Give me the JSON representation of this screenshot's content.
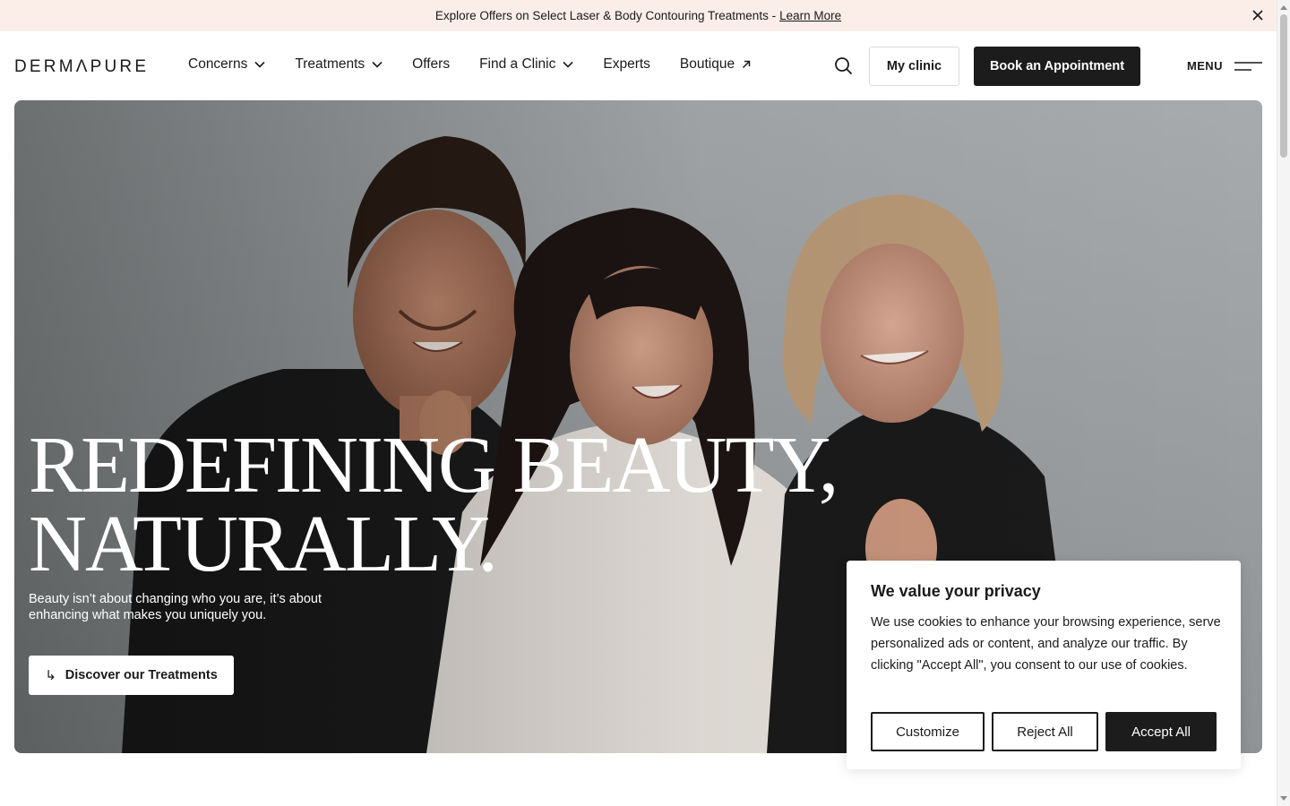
{
  "announcement": {
    "text": "Explore Offers on Select Laser & Body Contouring Treatments - ",
    "link": "Learn More",
    "close_icon": "close-icon"
  },
  "header": {
    "logo": "DERMΛPURE",
    "nav": [
      {
        "label": "Concerns",
        "dropdown": true
      },
      {
        "label": "Treatments",
        "dropdown": true
      },
      {
        "label": "Offers",
        "dropdown": false
      },
      {
        "label": "Find a Clinic",
        "dropdown": true
      },
      {
        "label": "Experts",
        "dropdown": false
      },
      {
        "label": "Boutique",
        "external": true
      }
    ],
    "search_icon": "search-icon",
    "my_clinic": "My clinic",
    "book": "Book an Appointment",
    "menu": "MENU",
    "menu_icon": "hamburger-icon"
  },
  "hero": {
    "title_line1": "REDEFINING BEAUTY,",
    "title_line2": "NATURALLY.",
    "subtitle": "Beauty isn’t about changing who you are, it’s about enhancing what makes you uniquely you.",
    "cta": "Discover our Treatments",
    "cta_icon": "↳"
  },
  "cookie": {
    "title": "We value your privacy",
    "body": "We use cookies to enhance your browsing experience, serve personalized ads or content, and analyze our traffic. By clicking \"Accept All\", you consent to our use of cookies.",
    "customize": "Customize",
    "reject": "Reject All",
    "accept": "Accept All"
  },
  "colors": {
    "announcement_bg": "#fbeee8",
    "primary_dark": "#1c1c1c",
    "hero_bg": "#9ea3a6"
  }
}
